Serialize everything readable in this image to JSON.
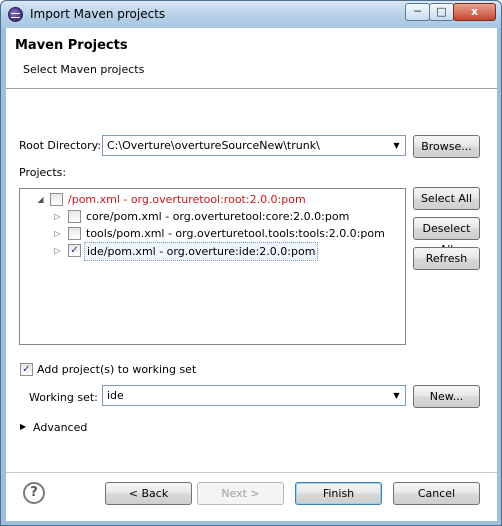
{
  "window": {
    "title": "Import Maven projects",
    "close_glyph": "x"
  },
  "header": {
    "title": "Maven Projects",
    "subtitle": "Select Maven projects"
  },
  "root": {
    "label": "Root Directory:",
    "value": "C:\\Overture\\overtureSourceNew\\trunk\\",
    "browse_label": "Browse..."
  },
  "projects": {
    "label": "Projects:",
    "items": [
      {
        "text": "/pom.xml - org.overturetool:root:2.0.0:pom",
        "checked": false,
        "expanded": true,
        "level": 0
      },
      {
        "text": "core/pom.xml - org.overturetool:core:2.0.0:pom",
        "checked": false,
        "expanded": false,
        "level": 1
      },
      {
        "text": "tools/pom.xml - org.overturetool.tools:tools:2.0.0:pom",
        "checked": false,
        "expanded": false,
        "level": 1
      },
      {
        "text": "ide/pom.xml - org.overture:ide:2.0.0:pom",
        "checked": true,
        "expanded": false,
        "level": 1
      }
    ],
    "select_all_label": "Select All",
    "deselect_all_label": "Deselect All",
    "refresh_label": "Refresh"
  },
  "working_set": {
    "checkbox_label": "Add project(s) to working set",
    "checked": true,
    "label": "Working set:",
    "value": "ide",
    "new_label": "New..."
  },
  "advanced": {
    "label": "Advanced"
  },
  "footer": {
    "back_label": "< Back",
    "next_label": "Next >",
    "finish_label": "Finish",
    "cancel_label": "Cancel"
  }
}
